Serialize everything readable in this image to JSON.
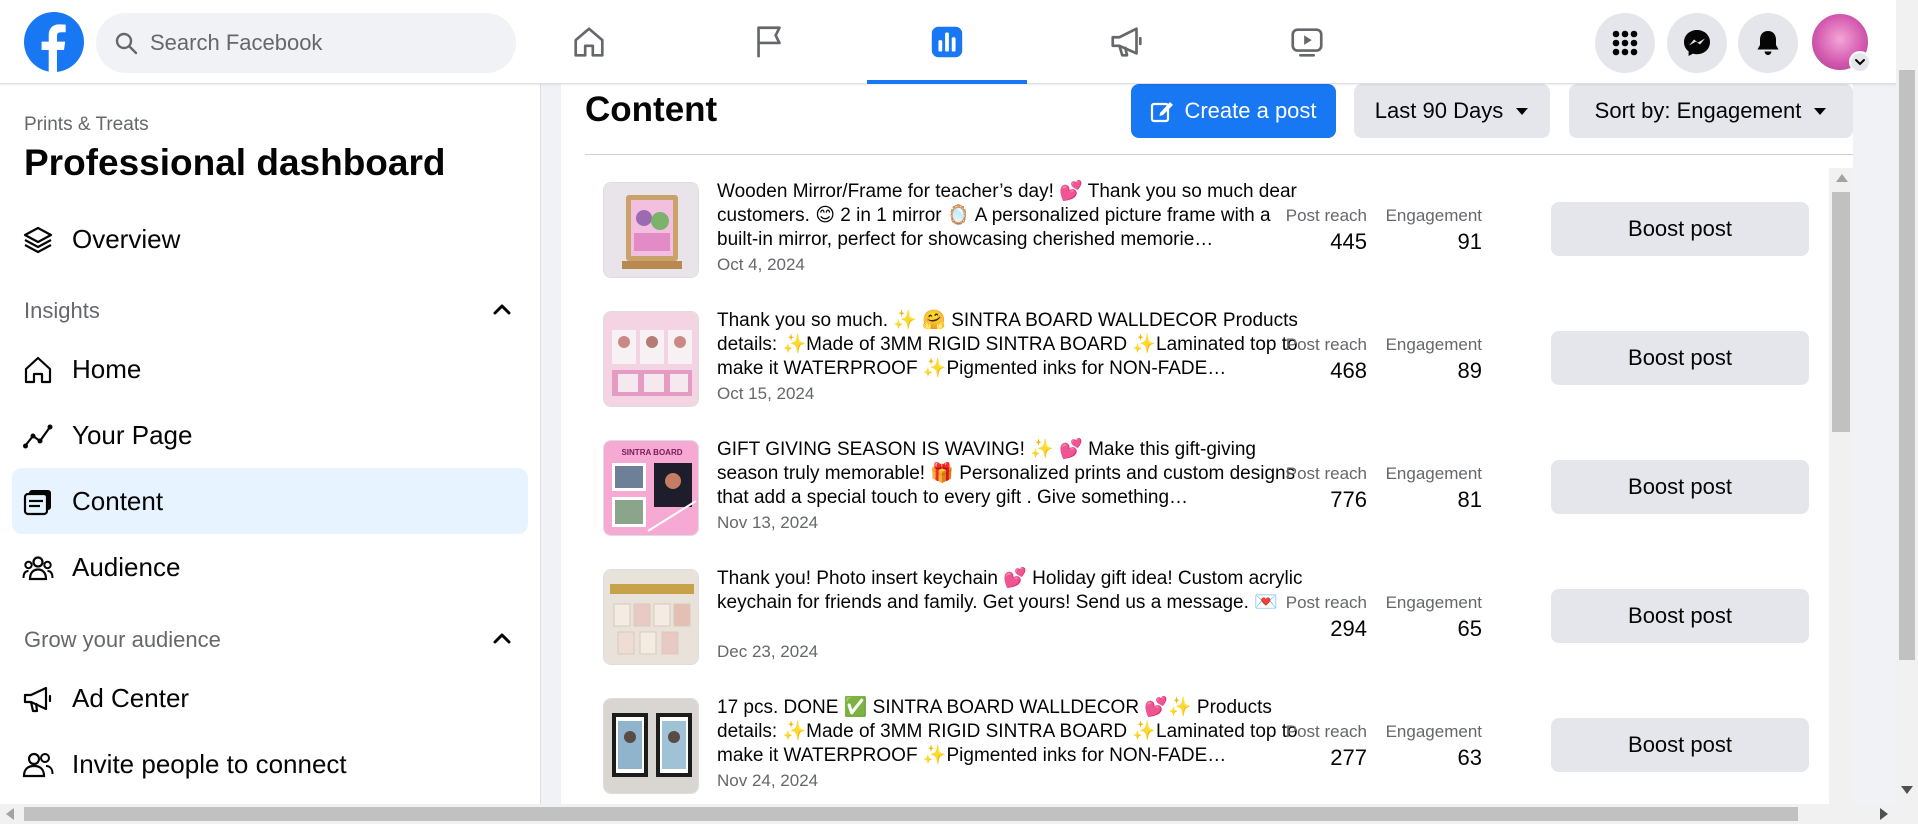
{
  "header": {
    "search_placeholder": "Search Facebook",
    "nav_tabs": [
      {
        "name": "home-icon",
        "active": false
      },
      {
        "name": "flag-icon",
        "active": false
      },
      {
        "name": "dashboard-icon",
        "active": true
      },
      {
        "name": "megaphone-icon",
        "active": false
      },
      {
        "name": "video-icon",
        "active": false
      }
    ],
    "right_buttons": [
      "menu-grid-icon",
      "messenger-icon",
      "bell-icon"
    ],
    "brand_color": "#1877f2"
  },
  "sidebar": {
    "page_name": "Prints & Treats",
    "title": "Professional dashboard",
    "overview_label": "Overview",
    "insights_heading": "Insights",
    "insights_items": [
      {
        "label": "Home",
        "icon": "home-outline-icon"
      },
      {
        "label": "Your Page",
        "icon": "trend-line-icon"
      },
      {
        "label": "Content",
        "icon": "content-icon",
        "active": true
      },
      {
        "label": "Audience",
        "icon": "people-icon"
      }
    ],
    "grow_heading": "Grow your audience",
    "grow_items": [
      {
        "label": "Ad Center",
        "icon": "megaphone-outline-icon"
      },
      {
        "label": "Invite people to connect",
        "icon": "invite-people-icon"
      }
    ]
  },
  "main": {
    "title": "Content",
    "create_post_label": "Create a post",
    "date_filter_label": "Last 90 Days",
    "sort_label": "Sort by: Engagement",
    "metric_reach_label": "Post reach",
    "metric_engagement_label": "Engagement",
    "boost_label": "Boost post",
    "posts": [
      {
        "text": "Wooden Mirror/Frame for teacher’s day! 💕 Thank you so much dear customers. 😊 2 in 1 mirror 🪞 A personalized picture frame with a built-in mirror, perfect for showcasing cherished memorie…",
        "date": "Oct 4, 2024",
        "reach": "445",
        "engagement": "91"
      },
      {
        "text": "Thank you so much. ✨ 🤗 SINTRA BOARD WALLDECOR Products details: ✨Made of 3MM RIGID SINTRA BOARD ✨Laminated top to make it WATERPROOF ✨Pigmented inks for NON-FADE…",
        "date": "Oct 15, 2024",
        "reach": "468",
        "engagement": "89"
      },
      {
        "text": "GIFT GIVING SEASON IS WAVING! ✨ 💕 Make this gift-giving season truly memorable! 🎁 Personalized prints and custom designs that add a special touch to every gift . Give something…",
        "date": "Nov 13, 2024",
        "reach": "776",
        "engagement": "81",
        "thumb_caption": "SINTRA BOARD"
      },
      {
        "text": "Thank you! Photo insert keychain 💕 Holiday gift idea! Custom acrylic keychain for friends and family. Get yours! Send us a message. 💌",
        "date": "Dec 23, 2024",
        "reach": "294",
        "engagement": "65"
      },
      {
        "text": "17 pcs. DONE ✅ SINTRA BOARD WALLDECOR 💕✨ Products details: ✨Made of 3MM RIGID SINTRA BOARD ✨Laminated top to make it WATERPROOF ✨Pigmented inks for NON-FADE…",
        "date": "Nov 24, 2024",
        "reach": "277",
        "engagement": "63"
      }
    ]
  }
}
